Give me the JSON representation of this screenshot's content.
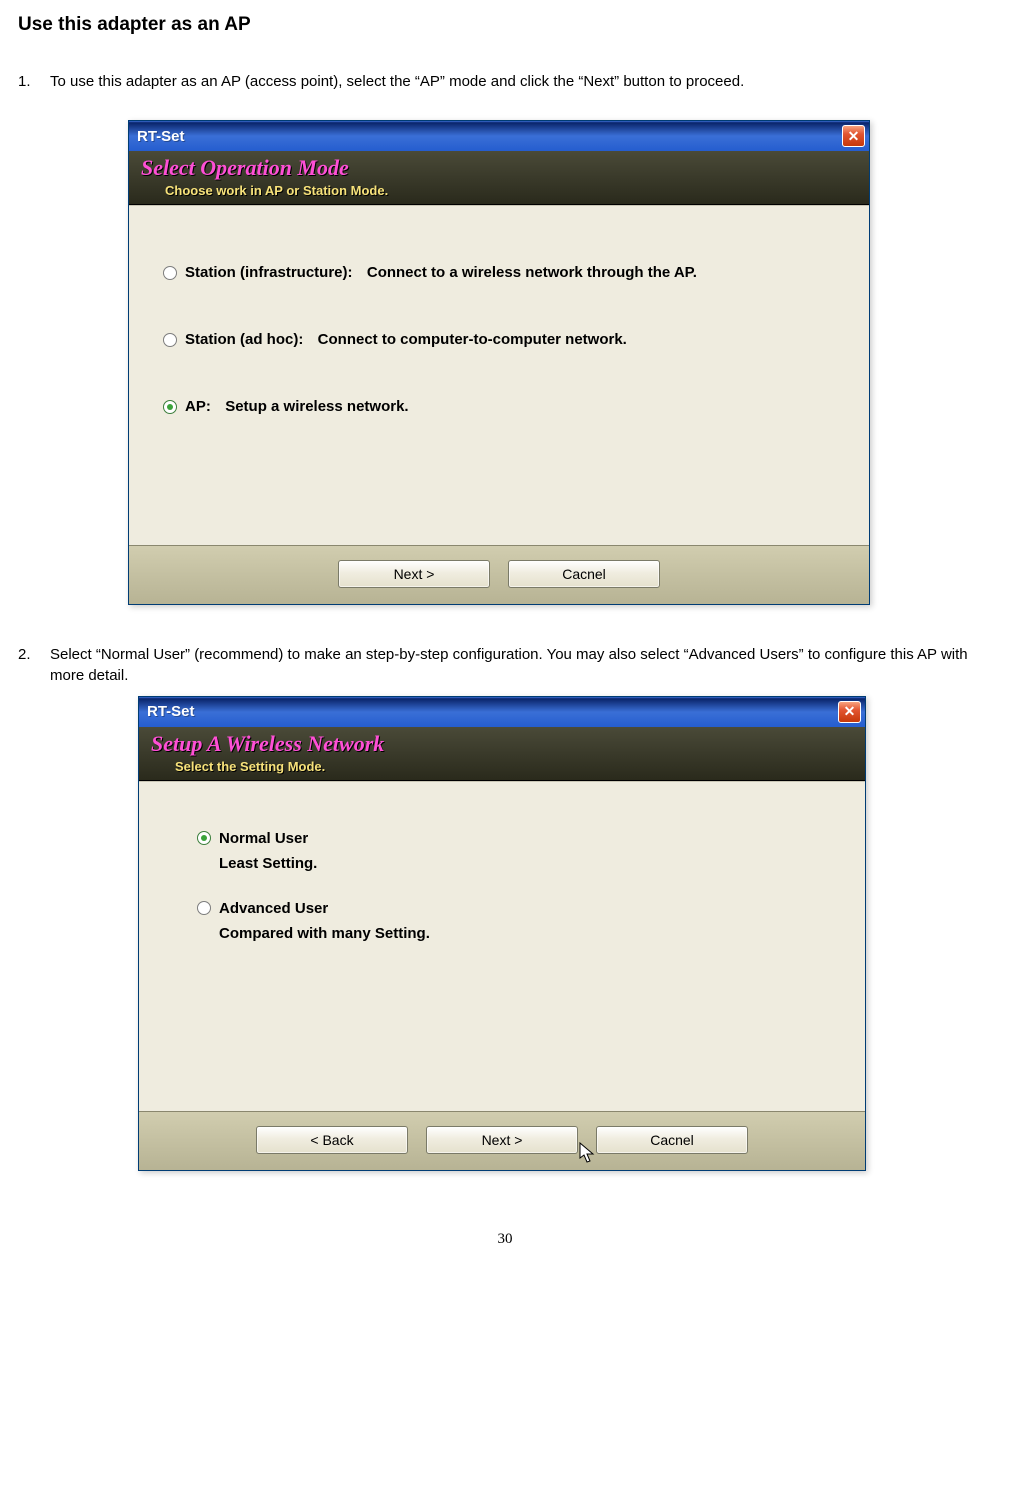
{
  "heading": "Use this adapter as an AP",
  "steps": {
    "1": {
      "num": "1.",
      "text": "To use this adapter as an AP (access point), select the “AP” mode and click the “Next” button to proceed."
    },
    "2": {
      "num": "2.",
      "text": "Select “Normal User” (recommend) to make an step-by-step configuration. You may also select “Advanced Users” to configure this AP with more detail."
    }
  },
  "window1": {
    "title": "RT-Set",
    "header_title": "Select Operation Mode",
    "header_sub": "Choose work in AP or Station Mode.",
    "options": {
      "infra": {
        "label": "Station (infrastructure):",
        "desc": "Connect to a wireless network through the AP."
      },
      "adhoc": {
        "label": "Station (ad hoc):",
        "desc": "Connect to computer-to-computer network."
      },
      "ap": {
        "label": "AP:",
        "desc": "Setup a wireless network."
      }
    },
    "buttons": {
      "next": "Next >",
      "cancel": "Cacnel"
    }
  },
  "window2": {
    "title": "RT-Set",
    "header_title": "Setup A Wireless Network",
    "header_sub": "Select the Setting Mode.",
    "options": {
      "normal": {
        "label": "Normal User",
        "desc": "Least Setting."
      },
      "advanced": {
        "label": "Advanced User",
        "desc": "Compared with many Setting."
      }
    },
    "buttons": {
      "back": "< Back",
      "next": "Next >",
      "cancel": "Cacnel"
    }
  },
  "page_number": "30"
}
